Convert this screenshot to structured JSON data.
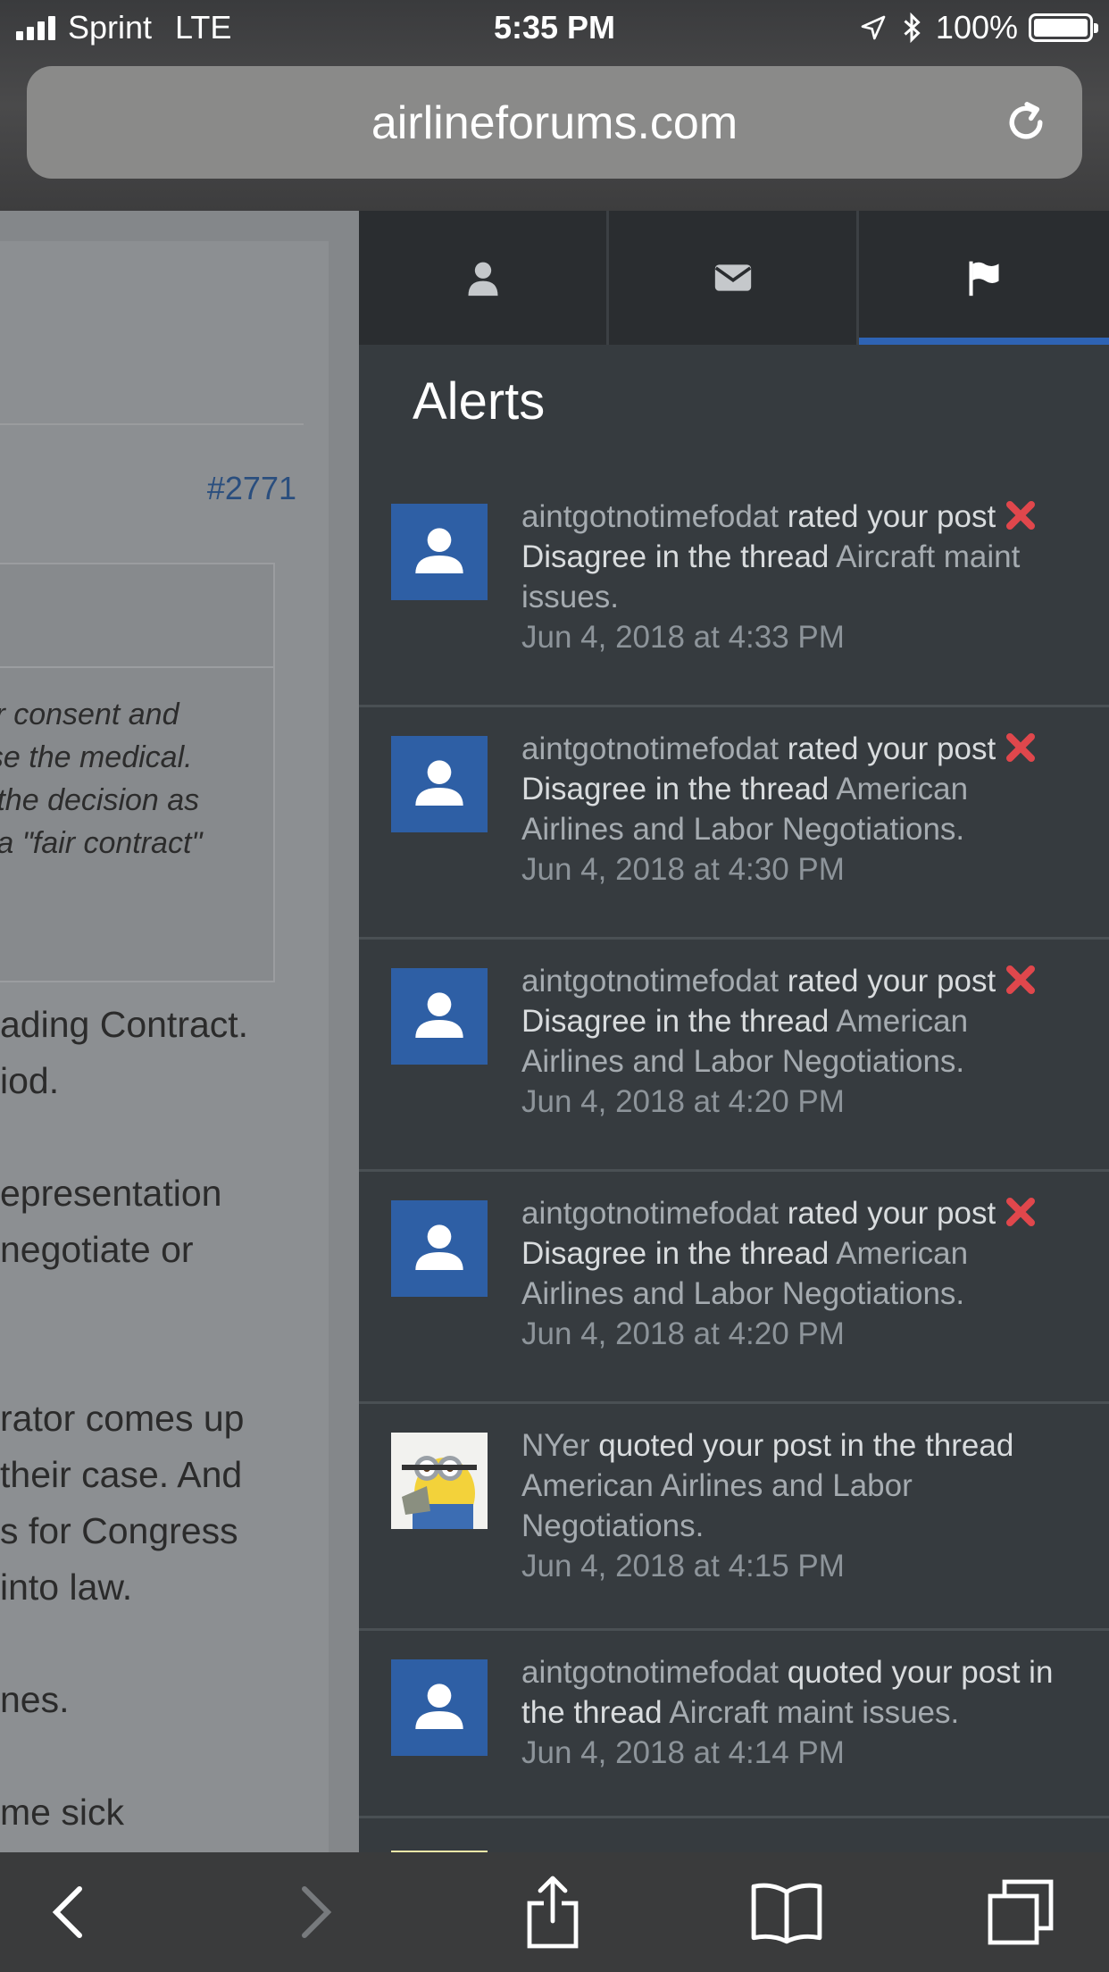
{
  "status_bar": {
    "carrier": "Sprint",
    "network": "LTE",
    "time": "5:35 PM",
    "battery": "100%"
  },
  "browser": {
    "url": "airlineforums.com"
  },
  "background_page": {
    "post_number": "#2771",
    "quote_lines": [
      "eir consent and",
      "ose the medical.",
      "",
      "n the decision as",
      "o a \"fair contract\""
    ],
    "body_lines": [
      "ading Contract.",
      "iod.",
      "",
      "epresentation",
      "negotiate or",
      "",
      "",
      "rator comes up",
      " their case. And",
      "s for Congress",
      " into law.",
      "",
      "nes.",
      "",
      "me sick"
    ]
  },
  "panel": {
    "title": "Alerts",
    "tabs": [
      {
        "icon": "user-icon",
        "active": false
      },
      {
        "icon": "envelope-icon",
        "active": false
      },
      {
        "icon": "flag-icon",
        "active": true
      }
    ],
    "alerts": [
      {
        "user": "aintgotnotimefodat",
        "action": "rated your post",
        "rating": "Disagree",
        "mid": "in the thread",
        "thread": "Aircraft maint issues.",
        "date": "Jun 4, 2018 at 4:33 PM"
      },
      {
        "user": "aintgotnotimefodat",
        "action": "rated your post",
        "rating": "Disagree",
        "mid": "in the thread",
        "thread": "American Airlines and Labor Negotiations.",
        "date": "Jun 4, 2018 at 4:30 PM"
      },
      {
        "user": "aintgotnotimefodat",
        "action": "rated your post",
        "rating": "Disagree",
        "mid": "in the thread",
        "thread": "American Airlines and Labor Negotiations.",
        "date": "Jun 4, 2018 at 4:20 PM"
      },
      {
        "user": "aintgotnotimefodat",
        "action": "rated your post",
        "rating": "Disagree",
        "mid": "in the thread",
        "thread": "American Airlines and Labor Negotiations.",
        "date": "Jun 4, 2018 at 4:20 PM"
      },
      {
        "user": "NYer",
        "action": "quoted your post in the thread",
        "thread": "American Airlines and Labor Negotiations.",
        "date": "Jun 4, 2018 at 4:15 PM"
      },
      {
        "user": "aintgotnotimefodat",
        "action": "quoted your post in the thread",
        "thread": "Aircraft maint issues.",
        "date": "Jun 4, 2018 at 4:14 PM"
      }
    ]
  },
  "colors": {
    "accent": "#2e63b4",
    "avatar_bg": "#2e5fa5",
    "panel_bg": "#363b3f",
    "disagree_x": "#e0474c"
  }
}
